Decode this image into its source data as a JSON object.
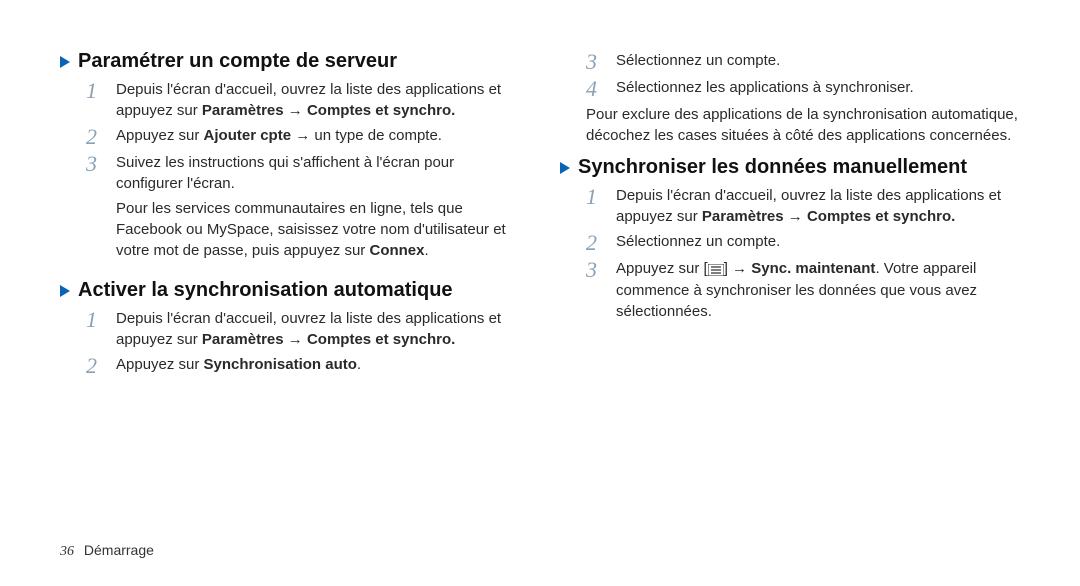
{
  "left": {
    "section1": {
      "title": "Paramétrer un compte de serveur",
      "steps": [
        {
          "num": "1",
          "pre": "Depuis l'écran d'accueil, ouvrez la liste des applications et appuyez sur ",
          "bold": "Paramètres → Comptes et synchro."
        },
        {
          "num": "2",
          "pre": "Appuyez sur ",
          "bold": "Ajouter cpte",
          "post": " → un type de compte."
        },
        {
          "num": "3",
          "pre": "Suivez les instructions qui s'affichent à l'écran pour configurer l'écran."
        }
      ],
      "note_pre": "Pour les services communautaires en ligne, tels que Facebook ou MySpace, saisissez votre nom d'utilisateur et votre mot de passe, puis appuyez sur ",
      "note_bold": "Connex",
      "note_post": "."
    },
    "section2": {
      "title": "Activer la synchronisation automatique",
      "steps": [
        {
          "num": "1",
          "pre": "Depuis l'écran d'accueil, ouvrez la liste des applications et appuyez sur ",
          "bold": "Paramètres → Comptes et synchro."
        },
        {
          "num": "2",
          "pre": "Appuyez sur ",
          "bold": "Synchronisation auto",
          "post": "."
        }
      ]
    }
  },
  "right": {
    "steps_top": [
      {
        "num": "3",
        "pre": "Sélectionnez un compte."
      },
      {
        "num": "4",
        "pre": "Sélectionnez les applications à synchroniser."
      }
    ],
    "para": "Pour exclure des applications de la synchronisation automatique, décochez les cases situées à côté des applications concernées.",
    "section": {
      "title": "Synchroniser les données manuellement",
      "steps": [
        {
          "num": "1",
          "pre": "Depuis l'écran d'accueil, ouvrez la liste des applications et appuyez sur ",
          "bold": "Paramètres → Comptes et synchro."
        },
        {
          "num": "2",
          "pre": "Sélectionnez un compte."
        },
        {
          "num": "3",
          "pre1": "Appuyez sur [",
          "icon": "menu",
          "pre2": "] → ",
          "bold": "Sync. maintenant",
          "post": ". Votre appareil commence à synchroniser les données que vous avez sélectionnées."
        }
      ]
    }
  },
  "footer": {
    "page": "36",
    "label": "Démarrage"
  }
}
